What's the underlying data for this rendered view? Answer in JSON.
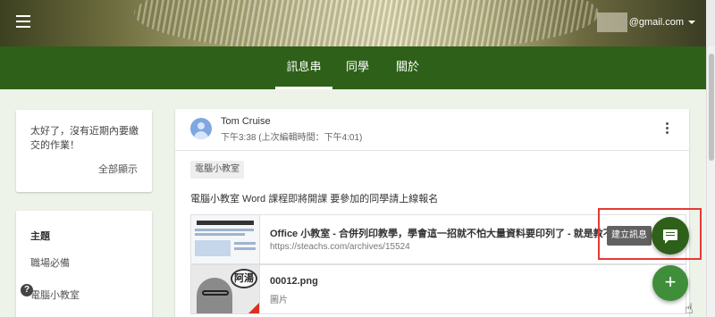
{
  "header": {
    "account_email": "@gmail.com"
  },
  "nav": {
    "tabs": [
      {
        "label": "訊息串",
        "active": true
      },
      {
        "label": "同學",
        "active": false
      },
      {
        "label": "關於",
        "active": false
      }
    ]
  },
  "sidebar": {
    "due_text": "太好了，沒有近期內要繳交的作業！",
    "view_all": "全部顯示",
    "topics_title": "主題",
    "topics": [
      "職場必備",
      "電腦小教室"
    ]
  },
  "post": {
    "author": "Tom Cruise",
    "time": "下午3:38 (上次編輯時間：下午4:01)",
    "topic_chip": "電腦小教室",
    "body": "電腦小教室 Word 課程即將開課 要參加的同學請上線報名",
    "attachments": [
      {
        "title": "Office 小教室 - 合併列印教學，學會這一招就不怕大量資料要印列了 - 就是教不落",
        "subtitle": "https://steachs.com/archives/15524"
      },
      {
        "title": "00012.png",
        "subtitle": "圖片",
        "thumb_text": "阿湯"
      }
    ]
  },
  "fab": {
    "tooltip": "建立訊息",
    "add_symbol": "+"
  },
  "help_symbol": "?"
}
